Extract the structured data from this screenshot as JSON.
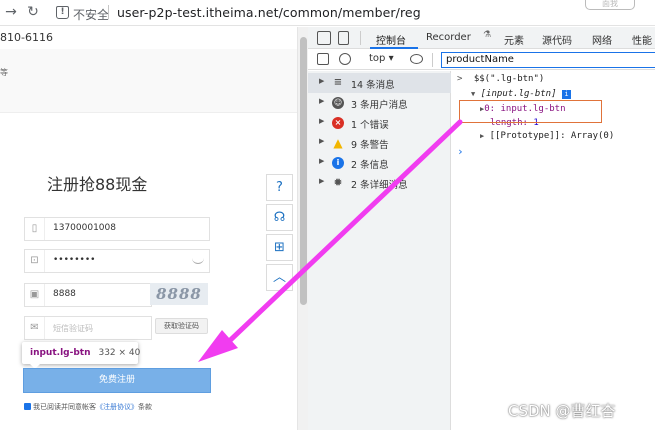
{
  "browser": {
    "insecure_label": "不安全",
    "url": "user-p2p-test.itheima.net/common/member/reg",
    "top_right_button": "面我"
  },
  "page": {
    "phone_partial": "810-6116",
    "band_text": "等",
    "title": "注册抢88现金",
    "phone_value": "13700001008",
    "password_value": "••••••••",
    "captcha_value": "8888",
    "captcha_image_text": "8888",
    "sms_placeholder": "短信验证码",
    "sms_button": "获取验证码",
    "register_button": "免费注册",
    "agree_text": "我已阅读并同意帐客",
    "agree_link": "《注册协议》",
    "agree_suffix": "条款"
  },
  "tooltip": {
    "selector": "input.lg-btn",
    "size": "332 × 40"
  },
  "devtools": {
    "tabs": [
      "控制台",
      "Recorder",
      "元素",
      "源代码",
      "网络",
      "性能"
    ],
    "context": "top",
    "filter_value": "productName",
    "sidebar": [
      {
        "label": "14 条消息",
        "icon": "list-icon",
        "color": "#555555"
      },
      {
        "label": "3 条用户消息",
        "icon": "user-icon",
        "color": "#555555"
      },
      {
        "label": "1 个错误",
        "icon": "error-icon",
        "color": "#d93025"
      },
      {
        "label": "9 条警告",
        "icon": "warning-icon",
        "color": "#f2b600"
      },
      {
        "label": "2 条信息",
        "icon": "info-icon",
        "color": "#1a73e8"
      },
      {
        "label": "2 条详细消息",
        "icon": "bug-icon",
        "color": "#555555"
      }
    ],
    "console": {
      "command": "$$(\".lg-btn\")",
      "result_head": "[input.lg-btn]",
      "item0_key": "0",
      "item0_val": "input.lg-btn",
      "length_key": "length",
      "length_val": "1",
      "proto": "[[Prototype]]: Array(0)"
    }
  },
  "watermark": "CSDN @曹红杏"
}
